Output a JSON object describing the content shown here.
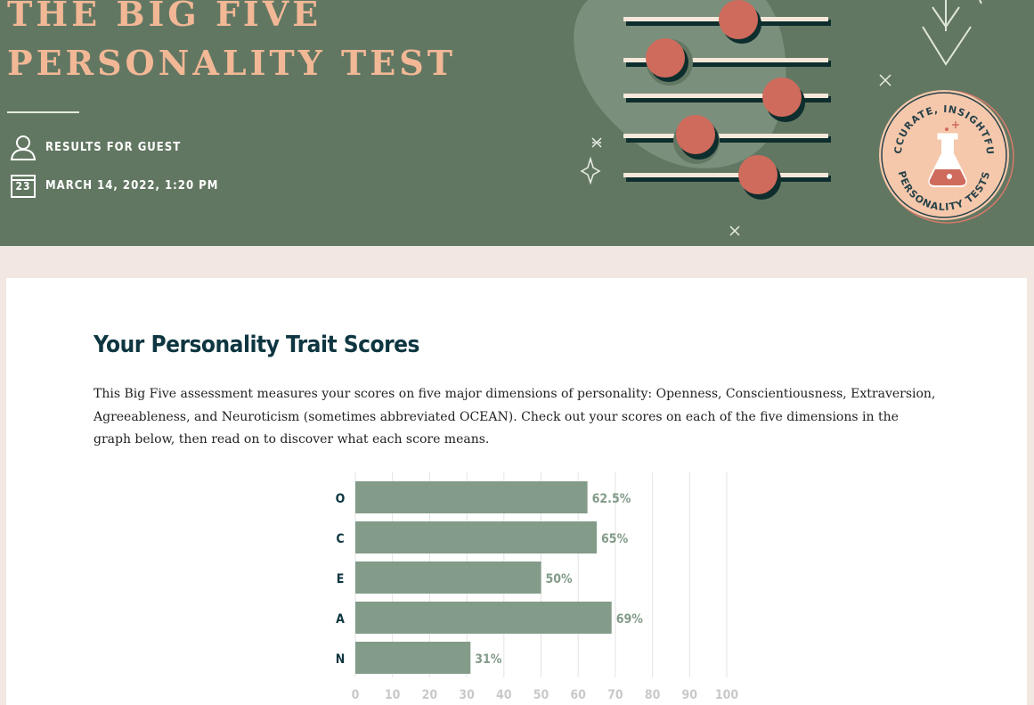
{
  "header": {
    "title_line1": "THE BIG FIVE",
    "title_line2": "PERSONALITY TEST",
    "results_for": "RESULTS FOR GUEST",
    "date": "MARCH 14, 2022, 1:20 PM",
    "calendar_day": "23",
    "badge_top": "ACCURATE, INSIGHTFUL",
    "badge_bottom": "PERSONALITY TESTS",
    "icons": [
      "user-icon",
      "calendar-icon",
      "sliders-illustration",
      "arrow-down-icon",
      "sparkle-icon",
      "flask-badge"
    ]
  },
  "colors": {
    "header_bg": "#627762",
    "title": "#f2b896",
    "page_bg": "#f3e7e1",
    "bar": "#839b89",
    "heading": "#0e3640",
    "knob": "#cf6b5c"
  },
  "main": {
    "heading": "Your Personality Trait Scores",
    "intro": "This Big Five assessment measures your scores on five major dimensions of personality: Openness, Conscientiousness, Extraversion, Agreeableness, and Neuroticism (sometimes abbreviated OCEAN). Check out your scores on each of the five dimensions in the graph below, then read on to discover what each score means."
  },
  "chart_data": {
    "type": "bar",
    "orientation": "horizontal",
    "categories": [
      "O",
      "C",
      "E",
      "A",
      "N"
    ],
    "values": [
      62.5,
      65,
      50,
      69,
      31
    ],
    "value_labels": [
      "62.5%",
      "65%",
      "50%",
      "69%",
      "31%"
    ],
    "xticks": [
      0,
      10,
      20,
      30,
      40,
      50,
      60,
      70,
      80,
      90,
      100
    ],
    "xlim": [
      0,
      100
    ],
    "grid": true,
    "legend": "none"
  }
}
